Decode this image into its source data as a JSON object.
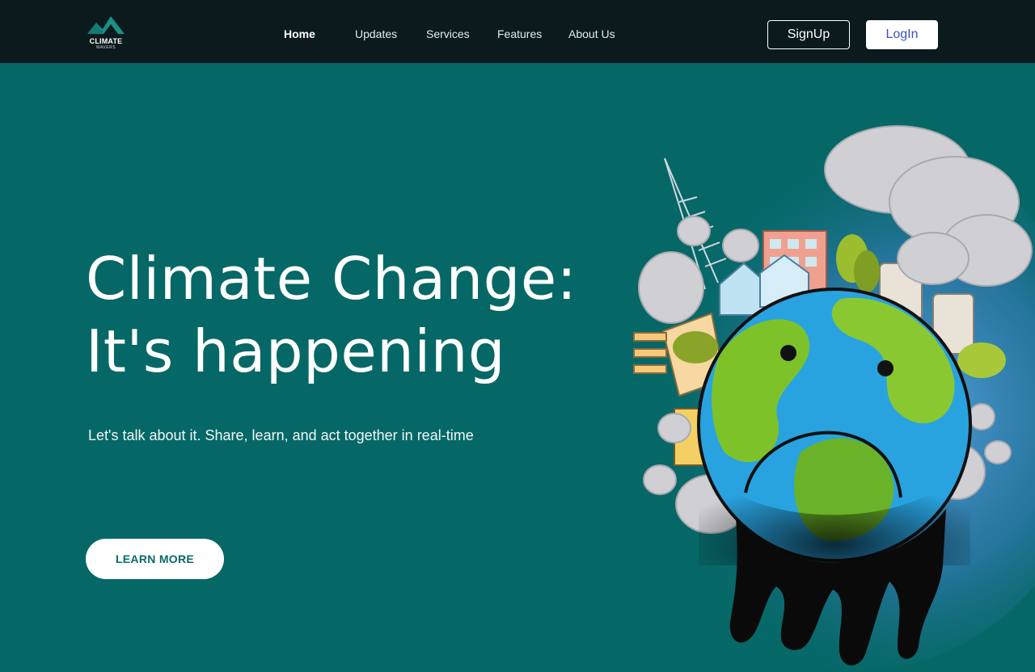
{
  "brand": {
    "name": "CLIMATE",
    "tagline": "WAVERS",
    "logo_color": "#1a8f86"
  },
  "nav": {
    "items": [
      {
        "label": "Home",
        "active": true
      },
      {
        "label": "Updates",
        "active": false
      },
      {
        "label": "Services",
        "active": false
      },
      {
        "label": "Features",
        "active": false
      },
      {
        "label": "About Us",
        "active": false
      }
    ]
  },
  "auth": {
    "signup_label": "SignUp",
    "login_label": "LogIn"
  },
  "hero": {
    "title_line1": "Climate Change:",
    "title_line2": "It's happening",
    "subtitle": "Let's talk about it. Share, learn, and act together in real-time",
    "cta_label": "LEARN MORE"
  },
  "illustration": {
    "icon": "melting-earth-illustration"
  },
  "colors": {
    "header_bg": "#0b1a1d",
    "page_bg": "#056866",
    "login_text": "#3a4fc7",
    "cta_text": "#086a67"
  }
}
